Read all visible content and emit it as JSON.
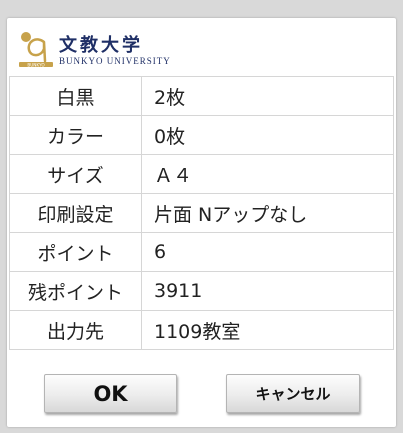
{
  "logo": {
    "name_kanji": "文教大学",
    "name_roman": "BUNKYO UNIVERSITY",
    "mark_text": "BUNKYO",
    "colors": {
      "brand_navy": "#1f2f66",
      "mark_gold": "#c7a24b"
    }
  },
  "rows": [
    {
      "label": "白黒",
      "value": "2枚"
    },
    {
      "label": "カラー",
      "value": "0枚"
    },
    {
      "label": "サイズ",
      "value": "Ａ４"
    },
    {
      "label": "印刷設定",
      "value": "片面 Nアップなし"
    },
    {
      "label": "ポイント",
      "value": "6"
    },
    {
      "label": "残ポイント",
      "value": "3911"
    },
    {
      "label": "出力先",
      "value": "1109教室"
    }
  ],
  "buttons": {
    "ok_label": "OK",
    "cancel_label": "キャンセル"
  }
}
